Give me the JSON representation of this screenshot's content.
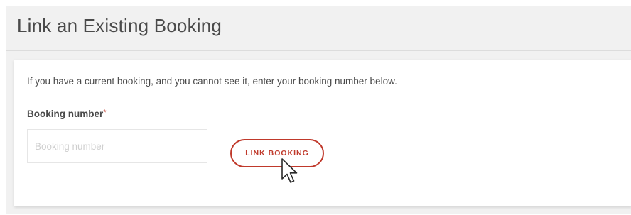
{
  "page": {
    "title": "Link an Existing Booking"
  },
  "card": {
    "intro": "If you have a current booking, and you cannot see it, enter your booking number below.",
    "field_label": "Booking number",
    "required_marker": "*",
    "input_placeholder": "Booking number",
    "input_value": "",
    "button_label": "LINK BOOKING"
  },
  "icons": {
    "cursor": "mouse-pointer-icon"
  },
  "colors": {
    "accent": "#c0392b",
    "panel_background": "#f1f1f1",
    "card_background": "#ffffff",
    "text": "#4a4a4a"
  }
}
